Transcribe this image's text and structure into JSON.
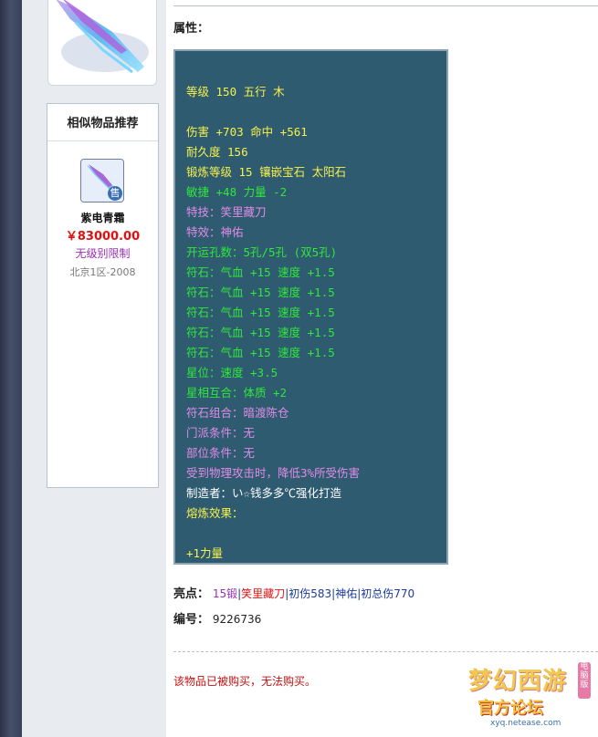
{
  "sidebar": {
    "similar_title": "相似物品推荐",
    "similar_item": {
      "name": "紫电青霜",
      "price": "￥83000.00",
      "limit": "无级别限制",
      "server": "北京1区-2008",
      "badge": "售"
    }
  },
  "main": {
    "attr_heading": "属性：",
    "stats": [
      {
        "text": "等级 150 五行 木",
        "color": "yellow"
      },
      {
        "text": "",
        "color": "blank"
      },
      {
        "text": "伤害 +703 命中 +561",
        "color": "yellow"
      },
      {
        "text": "耐久度 156",
        "color": "yellow"
      },
      {
        "text": "锻炼等级 15 镶嵌宝石 太阳石",
        "color": "yellow"
      },
      {
        "text": "敏捷 +48 力量 -2",
        "color": "green"
      },
      {
        "text": "特技：笑里藏刀",
        "color": "violet"
      },
      {
        "text": "特效：神佑",
        "color": "violet"
      },
      {
        "text": "开运孔数：5孔/5孔 (双5孔)",
        "color": "green"
      },
      {
        "text": "符石：气血 +15 速度 +1.5",
        "color": "green"
      },
      {
        "text": "符石：气血 +15 速度 +1.5",
        "color": "green"
      },
      {
        "text": "符石：气血 +15 速度 +1.5",
        "color": "green"
      },
      {
        "text": "符石：气血 +15 速度 +1.5",
        "color": "green"
      },
      {
        "text": "符石：气血 +15 速度 +1.5",
        "color": "green"
      },
      {
        "text": "星位：速度 +3.5",
        "color": "green"
      },
      {
        "text": "星相互合：体质 +2",
        "color": "green"
      },
      {
        "text": "符石组合：暗渡陈仓",
        "color": "violet"
      },
      {
        "text": "门派条件：无",
        "color": "violet"
      },
      {
        "text": "部位条件：无",
        "color": "violet"
      },
      {
        "text": "受到物理攻击时，降低3%所受伤害",
        "color": "violet"
      },
      {
        "text": "制造者：い☆钱多多℃强化打造",
        "color": "white"
      },
      {
        "text": "熔炼效果：",
        "color": "yellow"
      },
      {
        "text": "",
        "color": "blank"
      },
      {
        "text": "+1力量",
        "color": "yellow"
      }
    ],
    "highlights": {
      "label": "亮点：",
      "items": [
        {
          "text": "15锻",
          "color": "purple"
        },
        {
          "text": "笑里藏刀",
          "color": "red"
        },
        {
          "text": "初伤583",
          "color": "link"
        },
        {
          "text": "神佑",
          "color": "link"
        },
        {
          "text": "初总伤770",
          "color": "link"
        }
      ],
      "separator": "|"
    },
    "serial": {
      "label": "编号：",
      "value": "9226736"
    },
    "status_message": "该物品已被购买，无法购买。"
  },
  "logo": {
    "title": "梦幻西游",
    "subtitle": "官方论坛",
    "url": "xyq.netease.com",
    "tag": "电脑版"
  },
  "colors": {
    "stat_box_bg": "#2f5b70",
    "yellow": "#f7f14a",
    "green": "#2fe83a",
    "violet": "#e08be8",
    "price_red": "#e01010"
  }
}
